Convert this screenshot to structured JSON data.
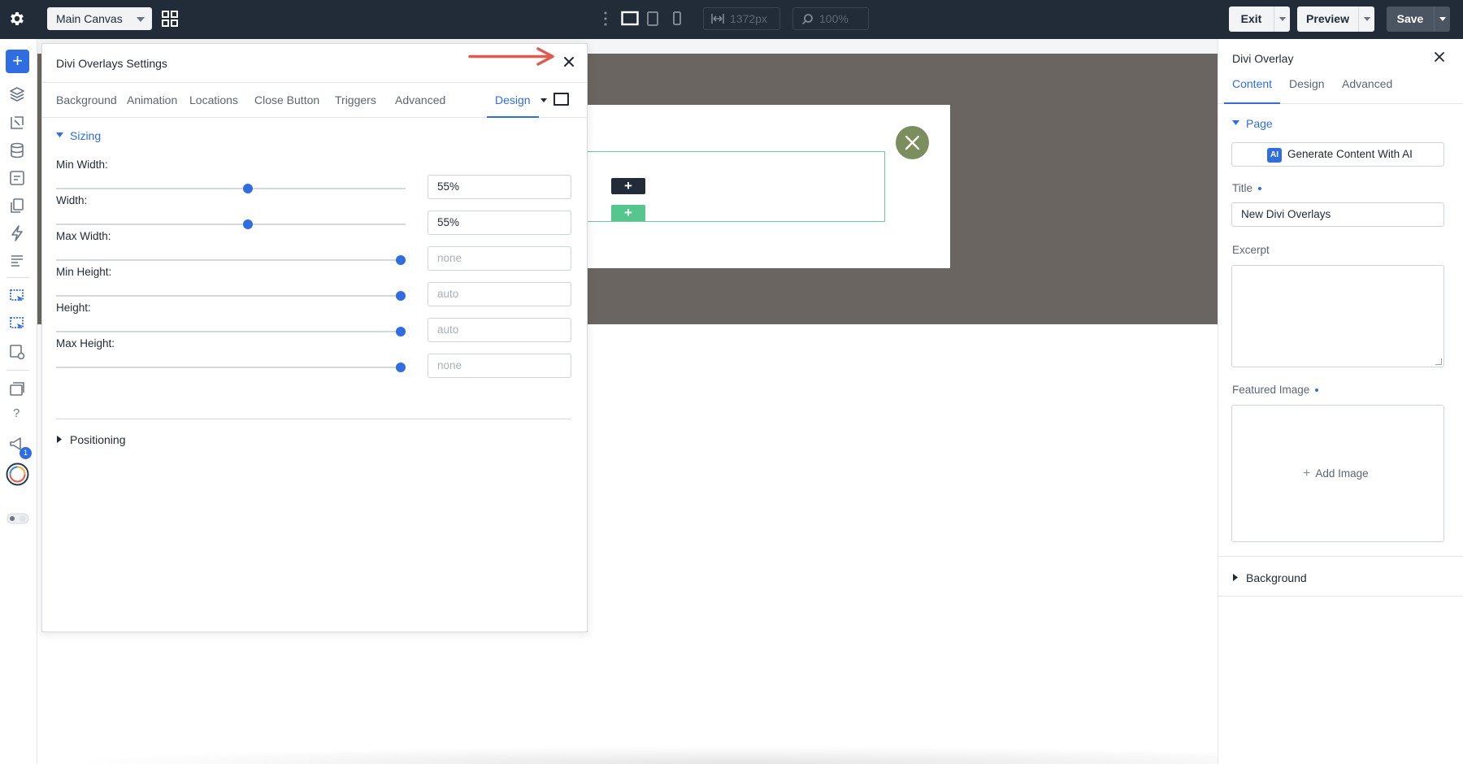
{
  "topbar": {
    "canvas_select": "Main Canvas",
    "width_value": "1372px",
    "zoom_value": "100%",
    "exit_label": "Exit",
    "preview_label": "Preview",
    "save_label": "Save"
  },
  "sidebar": {
    "notification_count": "1"
  },
  "canvas": {
    "add_row": "+",
    "add_section": "+"
  },
  "modal": {
    "title": "Divi Overlays Settings",
    "tabs": [
      "Background",
      "Animation",
      "Locations",
      "Close Button",
      "Triggers",
      "Advanced",
      "Design"
    ],
    "active_tab": "Design",
    "sizing_group": "Sizing",
    "positioning_group": "Positioning",
    "fields": [
      {
        "label": "Min Width:",
        "value": "55%",
        "placeholder": "",
        "slider": 0.55
      },
      {
        "label": "Width:",
        "value": "55%",
        "placeholder": "",
        "slider": 0.55
      },
      {
        "label": "Max Width:",
        "value": "",
        "placeholder": "none",
        "slider": 1
      },
      {
        "label": "Min Height:",
        "value": "",
        "placeholder": "auto",
        "slider": 1
      },
      {
        "label": "Height:",
        "value": "",
        "placeholder": "auto",
        "slider": 1
      },
      {
        "label": "Max Height:",
        "value": "",
        "placeholder": "none",
        "slider": 1
      }
    ]
  },
  "right_panel": {
    "title": "Divi Overlay",
    "tabs": [
      "Content",
      "Design",
      "Advanced"
    ],
    "active_tab": "Content",
    "page_group": "Page",
    "ai_button": "Generate Content With AI",
    "ai_badge": "AI",
    "title_label": "Title",
    "title_value": "New Divi Overlays",
    "excerpt_label": "Excerpt",
    "featured_image_label": "Featured Image",
    "add_image_label": "Add Image",
    "background_group": "Background"
  },
  "colors": {
    "topbar": "#222b38",
    "accent": "#2f6de1",
    "canvas_dark": "#6a6561",
    "close_circle": "#7c8e5d",
    "section_outline": "#6ec8a2",
    "annotation_arrow": "#e05a4f"
  }
}
